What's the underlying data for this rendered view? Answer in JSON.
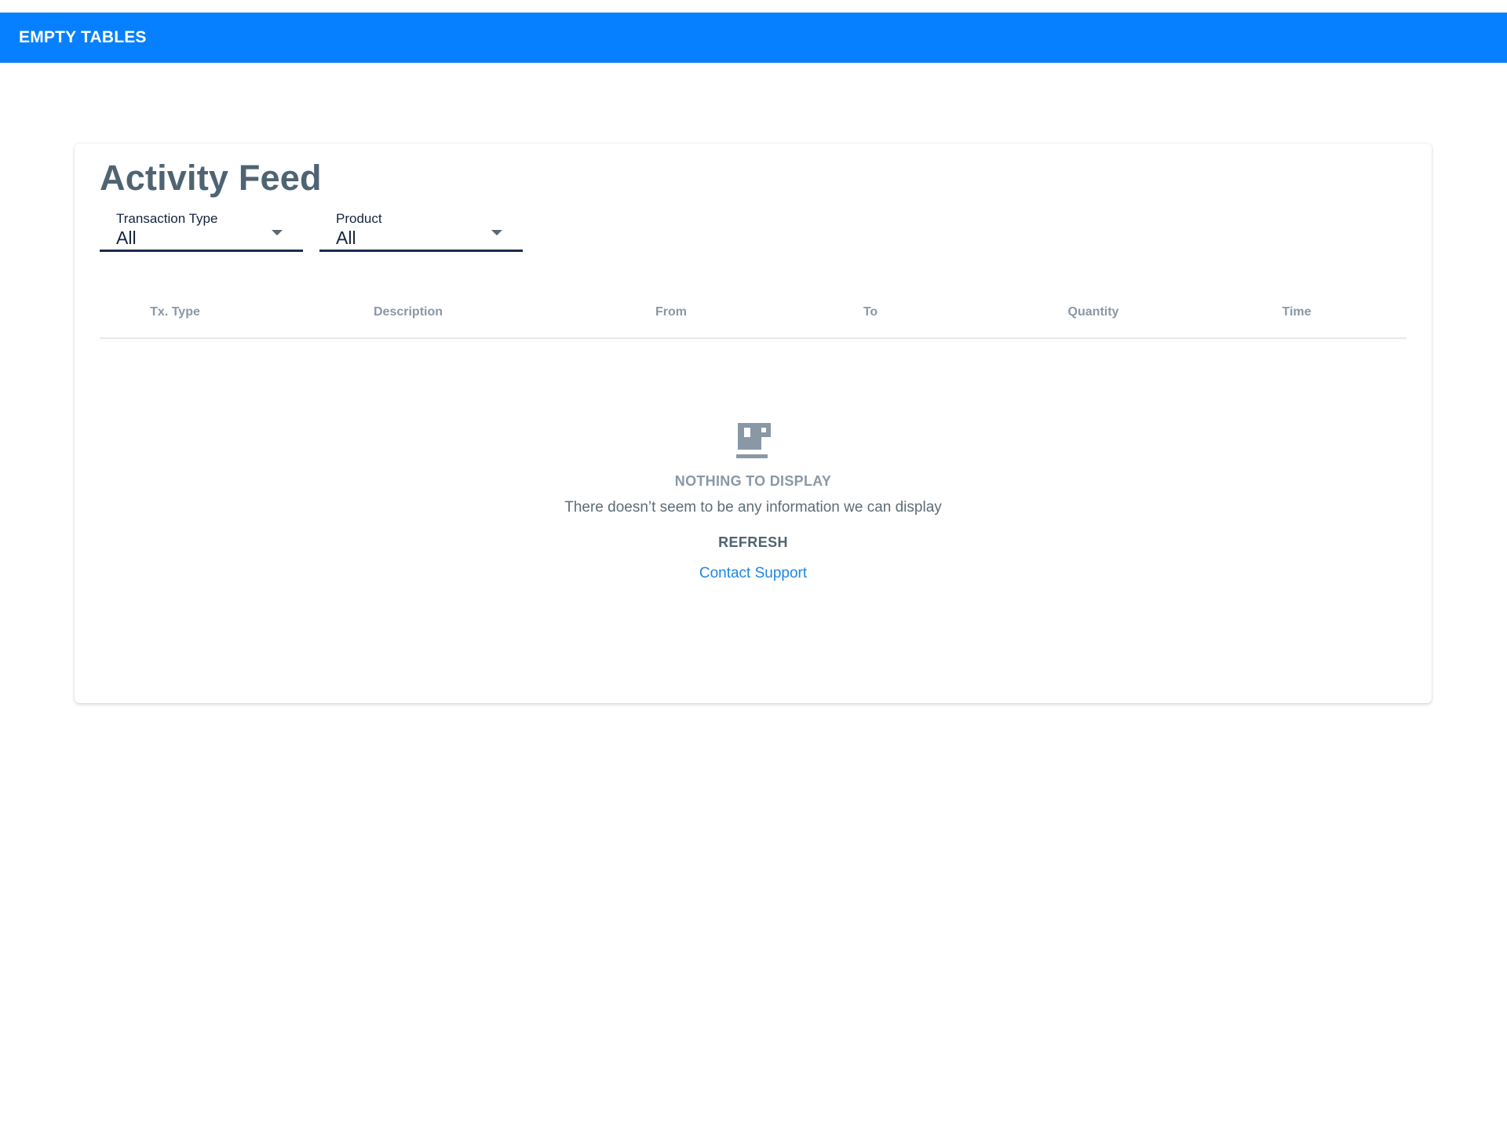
{
  "app_bar": {
    "title": "EMPTY TABLES",
    "color": "#0780ff"
  },
  "card": {
    "title": "Activity Feed",
    "filters": [
      {
        "label": "Transaction Type",
        "value": "All"
      },
      {
        "label": "Product",
        "value": "All"
      }
    ],
    "table": {
      "columns": [
        "Tx. Type",
        "Description",
        "From",
        "To",
        "Quantity",
        "Time"
      ],
      "rows": []
    },
    "empty_state": {
      "icon": "coffee-mug-icon",
      "heading": "NOTHING TO DISPLAY",
      "message": "There doesn’t seem to be any information we can display",
      "refresh_label": "REFRESH",
      "support_link": "Contact Support"
    }
  },
  "colors": {
    "link": "#1e87e6",
    "heading": "#4f6472",
    "muted": "#8a98a6"
  }
}
